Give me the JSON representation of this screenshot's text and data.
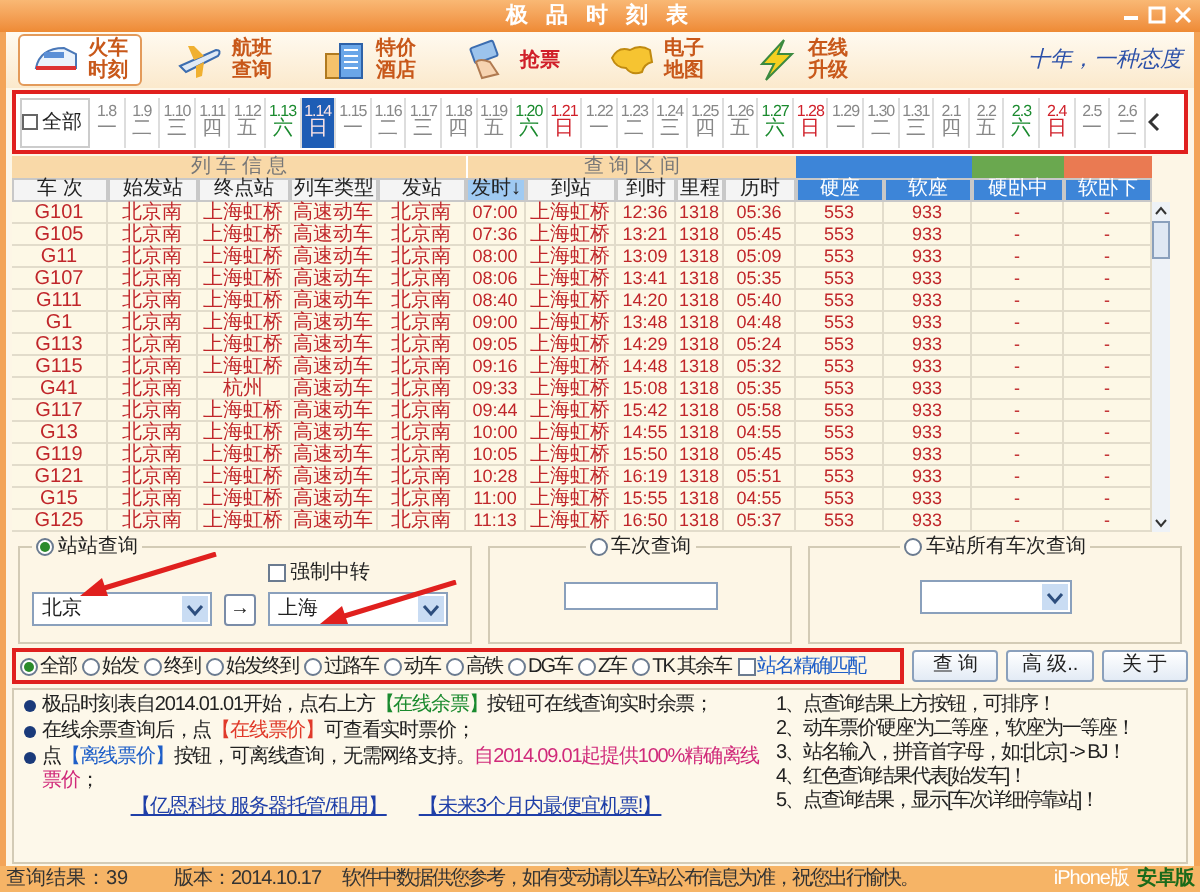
{
  "window": {
    "title": "极 品 时 刻 表"
  },
  "toolbar": [
    {
      "kind": "train",
      "lines": [
        "火车",
        "时刻"
      ],
      "selected": true
    },
    {
      "kind": "plane",
      "lines": [
        "航班",
        "查询"
      ],
      "selected": false
    },
    {
      "kind": "hotel",
      "lines": [
        "特价",
        "酒店"
      ],
      "selected": false
    },
    {
      "kind": "ticket",
      "lines": [
        "抢票"
      ],
      "selected": false
    },
    {
      "kind": "map",
      "lines": [
        "电子",
        "地图"
      ],
      "selected": false
    },
    {
      "kind": "upgrade",
      "lines": [
        "在线",
        "升级"
      ],
      "selected": false
    }
  ],
  "slogan": "十年，一种态度",
  "dates": {
    "all": {
      "label": "全部",
      "checked": false
    },
    "items": [
      {
        "date": "1.8",
        "weekday": "一",
        "kind": "weekday",
        "selected": false
      },
      {
        "date": "1.9",
        "weekday": "二",
        "kind": "weekday",
        "selected": false
      },
      {
        "date": "1.10",
        "weekday": "三",
        "kind": "weekday",
        "selected": false
      },
      {
        "date": "1.11",
        "weekday": "四",
        "kind": "weekday",
        "selected": false
      },
      {
        "date": "1.12",
        "weekday": "五",
        "kind": "weekday",
        "selected": false
      },
      {
        "date": "1.13",
        "weekday": "六",
        "kind": "saturday",
        "selected": false
      },
      {
        "date": "1.14",
        "weekday": "日",
        "kind": "sunday",
        "selected": true
      },
      {
        "date": "1.15",
        "weekday": "一",
        "kind": "weekday",
        "selected": false
      },
      {
        "date": "1.16",
        "weekday": "二",
        "kind": "weekday",
        "selected": false
      },
      {
        "date": "1.17",
        "weekday": "三",
        "kind": "weekday",
        "selected": false
      },
      {
        "date": "1.18",
        "weekday": "四",
        "kind": "weekday",
        "selected": false
      },
      {
        "date": "1.19",
        "weekday": "五",
        "kind": "weekday",
        "selected": false
      },
      {
        "date": "1.20",
        "weekday": "六",
        "kind": "saturday",
        "selected": false
      },
      {
        "date": "1.21",
        "weekday": "日",
        "kind": "sunday",
        "selected": false
      },
      {
        "date": "1.22",
        "weekday": "一",
        "kind": "weekday",
        "selected": false
      },
      {
        "date": "1.23",
        "weekday": "二",
        "kind": "weekday",
        "selected": false
      },
      {
        "date": "1.24",
        "weekday": "三",
        "kind": "weekday",
        "selected": false
      },
      {
        "date": "1.25",
        "weekday": "四",
        "kind": "weekday",
        "selected": false
      },
      {
        "date": "1.26",
        "weekday": "五",
        "kind": "weekday",
        "selected": false
      },
      {
        "date": "1.27",
        "weekday": "六",
        "kind": "saturday",
        "selected": false
      },
      {
        "date": "1.28",
        "weekday": "日",
        "kind": "sunday",
        "selected": false
      },
      {
        "date": "1.29",
        "weekday": "一",
        "kind": "weekday",
        "selected": false
      },
      {
        "date": "1.30",
        "weekday": "二",
        "kind": "weekday",
        "selected": false
      },
      {
        "date": "1.31",
        "weekday": "三",
        "kind": "weekday",
        "selected": false
      },
      {
        "date": "2.1",
        "weekday": "四",
        "kind": "weekday",
        "selected": false
      },
      {
        "date": "2.2",
        "weekday": "五",
        "kind": "weekday",
        "selected": false
      },
      {
        "date": "2.3",
        "weekday": "六",
        "kind": "saturday",
        "selected": false
      },
      {
        "date": "2.4",
        "weekday": "日",
        "kind": "sunday",
        "selected": false
      },
      {
        "date": "2.5",
        "weekday": "一",
        "kind": "weekday",
        "selected": false
      },
      {
        "date": "2.6",
        "weekday": "二",
        "kind": "weekday",
        "selected": false
      }
    ]
  },
  "table": {
    "groups": [
      {
        "label": "列 车 信 息"
      },
      {
        "label": "查 询 区 间"
      }
    ],
    "fare_groups": [
      {
        "color": "#3d85d8"
      },
      {
        "color": "#6aa84f"
      },
      {
        "color": "#ea7a52"
      }
    ],
    "columns": [
      {
        "label": "车 次",
        "sorted": false
      },
      {
        "label": "始发站",
        "sorted": false
      },
      {
        "label": "终点站",
        "sorted": false
      },
      {
        "label": "列车类型",
        "sorted": false
      },
      {
        "label": "发站",
        "sorted": false
      },
      {
        "label": "发时↓",
        "sorted": true
      },
      {
        "label": "到站",
        "sorted": false
      },
      {
        "label": "到时",
        "sorted": false
      },
      {
        "label": "里程",
        "sorted": false
      },
      {
        "label": "历时",
        "sorted": false
      },
      {
        "label": "硬座",
        "sorted": false
      },
      {
        "label": "软座",
        "sorted": false
      },
      {
        "label": "硬卧中",
        "sorted": false
      },
      {
        "label": "软卧下",
        "sorted": false
      }
    ],
    "rows": [
      [
        "G101",
        "北京南",
        "上海虹桥",
        "高速动车",
        "北京南",
        "07:00",
        "上海虹桥",
        "12:36",
        "1318",
        "05:36",
        "553",
        "933",
        "-",
        "-"
      ],
      [
        "G105",
        "北京南",
        "上海虹桥",
        "高速动车",
        "北京南",
        "07:36",
        "上海虹桥",
        "13:21",
        "1318",
        "05:45",
        "553",
        "933",
        "-",
        "-"
      ],
      [
        "G11",
        "北京南",
        "上海虹桥",
        "高速动车",
        "北京南",
        "08:00",
        "上海虹桥",
        "13:09",
        "1318",
        "05:09",
        "553",
        "933",
        "-",
        "-"
      ],
      [
        "G107",
        "北京南",
        "上海虹桥",
        "高速动车",
        "北京南",
        "08:06",
        "上海虹桥",
        "13:41",
        "1318",
        "05:35",
        "553",
        "933",
        "-",
        "-"
      ],
      [
        "G111",
        "北京南",
        "上海虹桥",
        "高速动车",
        "北京南",
        "08:40",
        "上海虹桥",
        "14:20",
        "1318",
        "05:40",
        "553",
        "933",
        "-",
        "-"
      ],
      [
        "G1",
        "北京南",
        "上海虹桥",
        "高速动车",
        "北京南",
        "09:00",
        "上海虹桥",
        "13:48",
        "1318",
        "04:48",
        "553",
        "933",
        "-",
        "-"
      ],
      [
        "G113",
        "北京南",
        "上海虹桥",
        "高速动车",
        "北京南",
        "09:05",
        "上海虹桥",
        "14:29",
        "1318",
        "05:24",
        "553",
        "933",
        "-",
        "-"
      ],
      [
        "G115",
        "北京南",
        "上海虹桥",
        "高速动车",
        "北京南",
        "09:16",
        "上海虹桥",
        "14:48",
        "1318",
        "05:32",
        "553",
        "933",
        "-",
        "-"
      ],
      [
        "G41",
        "北京南",
        "杭州",
        "高速动车",
        "北京南",
        "09:33",
        "上海虹桥",
        "15:08",
        "1318",
        "05:35",
        "553",
        "933",
        "-",
        "-"
      ],
      [
        "G117",
        "北京南",
        "上海虹桥",
        "高速动车",
        "北京南",
        "09:44",
        "上海虹桥",
        "15:42",
        "1318",
        "05:58",
        "553",
        "933",
        "-",
        "-"
      ],
      [
        "G13",
        "北京南",
        "上海虹桥",
        "高速动车",
        "北京南",
        "10:00",
        "上海虹桥",
        "14:55",
        "1318",
        "04:55",
        "553",
        "933",
        "-",
        "-"
      ],
      [
        "G119",
        "北京南",
        "上海虹桥",
        "高速动车",
        "北京南",
        "10:05",
        "上海虹桥",
        "15:50",
        "1318",
        "05:45",
        "553",
        "933",
        "-",
        "-"
      ],
      [
        "G121",
        "北京南",
        "上海虹桥",
        "高速动车",
        "北京南",
        "10:28",
        "上海虹桥",
        "16:19",
        "1318",
        "05:51",
        "553",
        "933",
        "-",
        "-"
      ],
      [
        "G15",
        "北京南",
        "上海虹桥",
        "高速动车",
        "北京南",
        "11:00",
        "上海虹桥",
        "15:55",
        "1318",
        "04:55",
        "553",
        "933",
        "-",
        "-"
      ],
      [
        "G125",
        "北京南",
        "上海虹桥",
        "高速动车",
        "北京南",
        "11:13",
        "上海虹桥",
        "16:50",
        "1318",
        "05:37",
        "553",
        "933",
        "-",
        "-"
      ]
    ]
  },
  "query": {
    "station": {
      "label": "站站查询",
      "selected": true,
      "from": "北京",
      "swap": "→",
      "to": "上海",
      "transfer": {
        "label": "强制中转",
        "checked": false
      }
    },
    "train": {
      "label": "车次查询",
      "selected": false
    },
    "all_trains": {
      "label": "车站所有车次查询",
      "selected": false
    }
  },
  "filters": [
    {
      "label": "全部",
      "selected": true
    },
    {
      "label": "始发",
      "selected": false
    },
    {
      "label": "终到",
      "selected": false
    },
    {
      "label": "始发终到",
      "selected": false
    },
    {
      "label": "过路车",
      "selected": false
    },
    {
      "label": "动车",
      "selected": false
    },
    {
      "label": "高铁",
      "selected": false
    },
    {
      "label": "DG车",
      "selected": false
    },
    {
      "label": "Z车",
      "selected": false
    },
    {
      "label": "TK 其余车",
      "selected": false
    }
  ],
  "exact_match": {
    "label": "站名精确匹配",
    "checked": false
  },
  "buttons": [
    "查 询",
    "高 级..",
    "关 于"
  ],
  "info": {
    "bullets": [
      [
        {
          "text": "极品时刻表自2014.01.01开始，点右上方"
        },
        {
          "text": "【在线余票】",
          "color": "#1a8a2e"
        },
        {
          "text": "按钮可在线查询实时余票；"
        }
      ],
      [
        {
          "text": "在线余票查询后，点"
        },
        {
          "text": "【在线票价】",
          "color": "#e03a2a"
        },
        {
          "text": "可查看实时票价；"
        }
      ],
      [
        {
          "text": "点"
        },
        {
          "text": "【离线票价】",
          "color": "#1f5fc8"
        },
        {
          "text": "按钮，可离线查询，无需网络支持。"
        },
        {
          "text": "自2014.09.01起提供100%精确离线票价",
          "color": "#d02a7a"
        },
        {
          "text": "；"
        }
      ]
    ],
    "links": [
      "【亿恩科技 服务器托管/租用】",
      "【未来3个月内最便宜机票!】"
    ],
    "notes": [
      "1、点查询结果上方按钮，可排序！",
      "2、动车票价'硬座'为二等座，'软座'为一等座！",
      "3、站名输入，拼音首字母，如:[北京] -> BJ！",
      "4、红色查询结果代表[始发车]！",
      "5、点查询结果，显示[车次详细停靠站]！"
    ]
  },
  "status": {
    "result": "查询结果：39",
    "version": "版本：2014.10.17",
    "message": "软件中数据供您参考，如有变动请以车站公布信息为准，祝您出行愉快。",
    "iphone": "iPhone版",
    "android": "安卓版"
  }
}
